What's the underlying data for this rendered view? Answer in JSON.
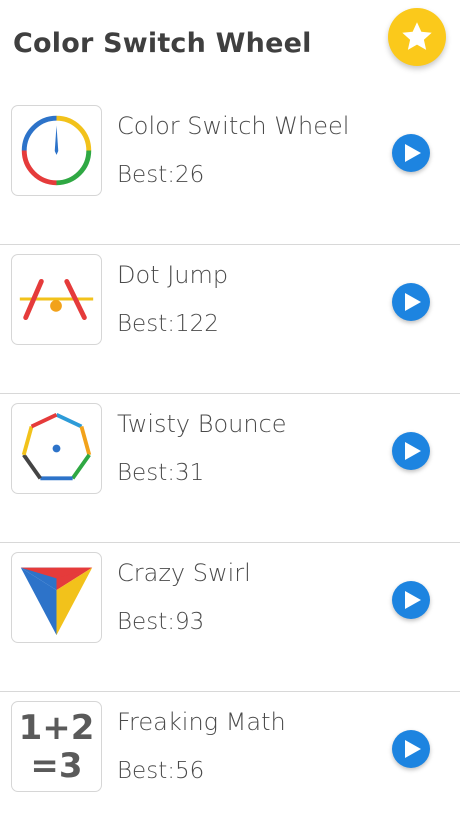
{
  "header": {
    "title": "Color Switch Wheel",
    "star_icon": "star-icon",
    "accent": "#fbc91b"
  },
  "games": [
    {
      "name": "Color Switch Wheel",
      "best": "Best:26",
      "icon": "color-wheel-icon"
    },
    {
      "name": "Dot Jump",
      "best": "Best:122",
      "icon": "dot-jump-icon"
    },
    {
      "name": "Twisty Bounce",
      "best": "Best:31",
      "icon": "twisty-bounce-icon"
    },
    {
      "name": "Crazy Swirl",
      "best": "Best:93",
      "icon": "crazy-swirl-icon"
    },
    {
      "name": "Freaking Math",
      "best": "Best:56",
      "icon": "freaking-math-icon",
      "icon_text": [
        "1+2",
        "=3"
      ]
    }
  ],
  "colors": {
    "play_button": "#1d84e0",
    "divider": "#d8d8d8"
  }
}
